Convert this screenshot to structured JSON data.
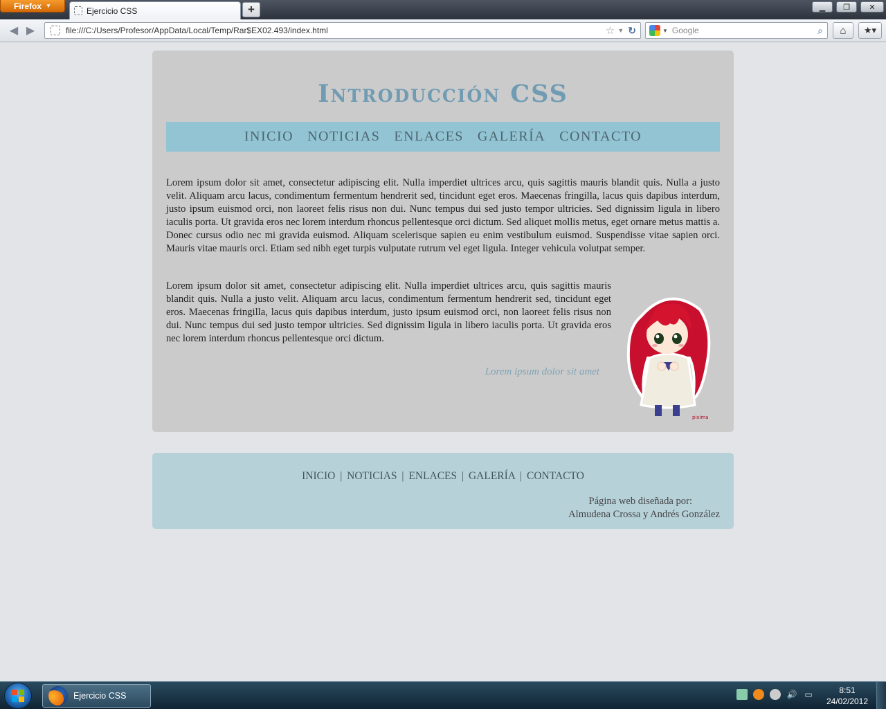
{
  "browser": {
    "app_button": "Firefox",
    "tab_title": "Ejercicio CSS",
    "new_tab": "+",
    "url": "file:///C:/Users/Profesor/AppData/Local/Temp/Rar$EX02.493/index.html",
    "search_placeholder": "Google"
  },
  "page": {
    "title": "Introducción CSS",
    "menu": [
      "INICIO",
      "NOTICIAS",
      "ENLACES",
      "GALERÍA",
      "CONTACTO"
    ],
    "paragraph1": "Lorem ipsum dolor sit amet, consectetur adipiscing elit. Nulla imperdiet ultrices arcu, quis sagittis mauris blandit quis. Nulla a justo velit. Aliquam arcu lacus, condimentum fermentum hendrerit sed, tincidunt eget eros. Maecenas fringilla, lacus quis dapibus interdum, justo ipsum euismod orci, non laoreet felis risus non dui. Nunc tempus dui sed justo tempor ultricies. Sed dignissim ligula in libero iaculis porta. Ut gravida eros nec lorem interdum rhoncus pellentesque orci dictum. Sed aliquet mollis metus, eget ornare metus mattis a. Donec cursus odio nec mi gravida euismod. Aliquam scelerisque sapien eu enim vestibulum euismod. Suspendisse vitae sapien orci. Mauris vitae mauris orci. Etiam sed nibh eget turpis vulputate rutrum vel eget ligula. Integer vehicula volutpat semper.",
    "paragraph2": "Lorem ipsum dolor sit amet, consectetur adipiscing elit. Nulla imperdiet ultrices arcu, quis sagittis mauris blandit quis. Nulla a justo velit. Aliquam arcu lacus, condimentum fermentum hendrerit sed, tincidunt eget eros. Maecenas fringilla, lacus quis dapibus interdum, justo ipsum euismod orci, non laoreet felis risus non dui. Nunc tempus dui sed justo tempor ultricies. Sed dignissim ligula in libero iaculis porta. Ut gravida eros nec lorem interdum rhoncus pellentesque orci dictum.",
    "caption": "Lorem ipsum dolor sit amet",
    "image_signature": "pixima"
  },
  "footer": {
    "nav": [
      "INICIO",
      "NOTICIAS",
      "ENLACES",
      "GALERÍA",
      "CONTACTO"
    ],
    "separator": "|",
    "credit_label": "Página web diseñada por:",
    "credit_names": "Almudena Crossa y Andrés González"
  },
  "taskbar": {
    "task_label": "Ejercicio CSS",
    "time": "8:51",
    "date": "24/02/2012"
  },
  "colors": {
    "background": "#e2e4e8",
    "wrapper": "#cbcbcb",
    "menu_bar": "#92c4d3",
    "title": "#6f9bb3",
    "footer": "#b7d1d9"
  }
}
